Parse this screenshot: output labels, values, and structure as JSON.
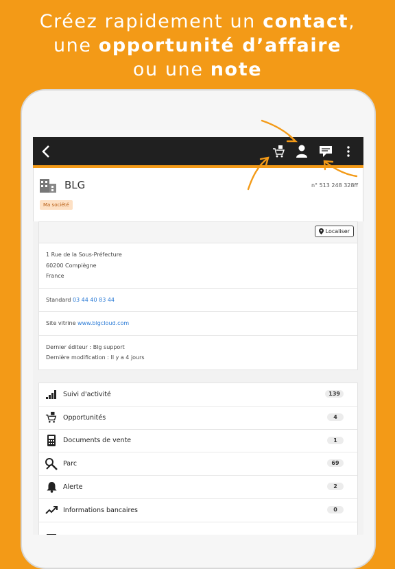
{
  "headline": {
    "line1_a": "Créez rapidement un ",
    "line1_b": "contact",
    "line1_c": ",",
    "line2_a": "une ",
    "line2_b": "opportunité d’affaire",
    "line3_a": "ou une ",
    "line3_b": "note"
  },
  "toolbar": {
    "back_icon": "chevron-left-icon",
    "opportunity_icon": "cart-icon",
    "contact_icon": "person-icon",
    "note_icon": "note-icon",
    "more_icon": "more-vertical-icon"
  },
  "company": {
    "name": "BLG",
    "number": "n° 513 248 328ff",
    "tag": "Ma société"
  },
  "details": {
    "locate_label": "Localiser",
    "address": [
      "1 Rue de la Sous-Préfecture",
      "60200 Compiègne",
      "France"
    ],
    "phone_label": "Standard",
    "phone": "03 44 40 83 44",
    "website_label": "Site vitrine",
    "website": "www.blgcloud.com",
    "editor": "Dernier éditeur : Blg support",
    "modified": "Dernière modification : Il y a 4 jours"
  },
  "list": [
    {
      "label": "Suivi d'activité",
      "count": "139",
      "icon": "signal-bars-icon"
    },
    {
      "label": "Opportunités",
      "count": "4",
      "icon": "cart-icon"
    },
    {
      "label": "Documents de vente",
      "count": "1",
      "icon": "calculator-icon"
    },
    {
      "label": "Parc",
      "count": "69",
      "icon": "tools-icon"
    },
    {
      "label": "Alerte",
      "count": "2",
      "icon": "bell-icon"
    },
    {
      "label": "Informations bancaires",
      "count": "0",
      "icon": "trend-up-icon"
    }
  ],
  "colors": {
    "brand_orange": "#f39a17",
    "topbar": "#202020",
    "link": "#2b7bd6",
    "tag_bg": "#fde0c4"
  }
}
